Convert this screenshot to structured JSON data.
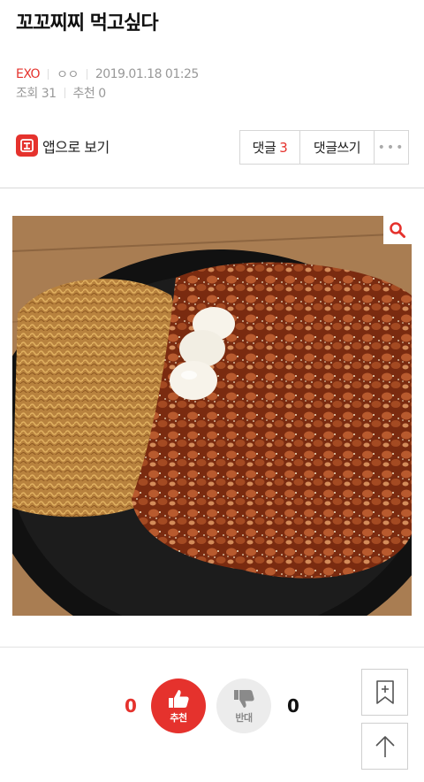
{
  "post": {
    "title": "꼬꼬찌찌 먹고싶다",
    "category": "EXO",
    "author": "ㅇㅇ",
    "datetime": "2019.01.18 01:25",
    "views_label": "조회 31",
    "recommend_label": "추천 0"
  },
  "toolbar": {
    "app_view_label": "앱으로 보기",
    "comments_label": "댓글",
    "comments_count": "3",
    "write_comment_label": "댓글쓰기",
    "more_label": "•••"
  },
  "image": {
    "description_icon": "search-icon"
  },
  "votes": {
    "up_count": "0",
    "up_label": "추천",
    "down_count": "0",
    "down_label": "반대"
  },
  "colors": {
    "accent": "#e5322d",
    "down_bg": "#ececec"
  },
  "icons": {
    "app": "app-logo-icon",
    "zoom": "search-icon",
    "up": "thumbs-up-icon",
    "down": "thumbs-down-icon",
    "bookmark": "bookmark-add-icon",
    "scroll_top": "arrow-up-icon"
  }
}
